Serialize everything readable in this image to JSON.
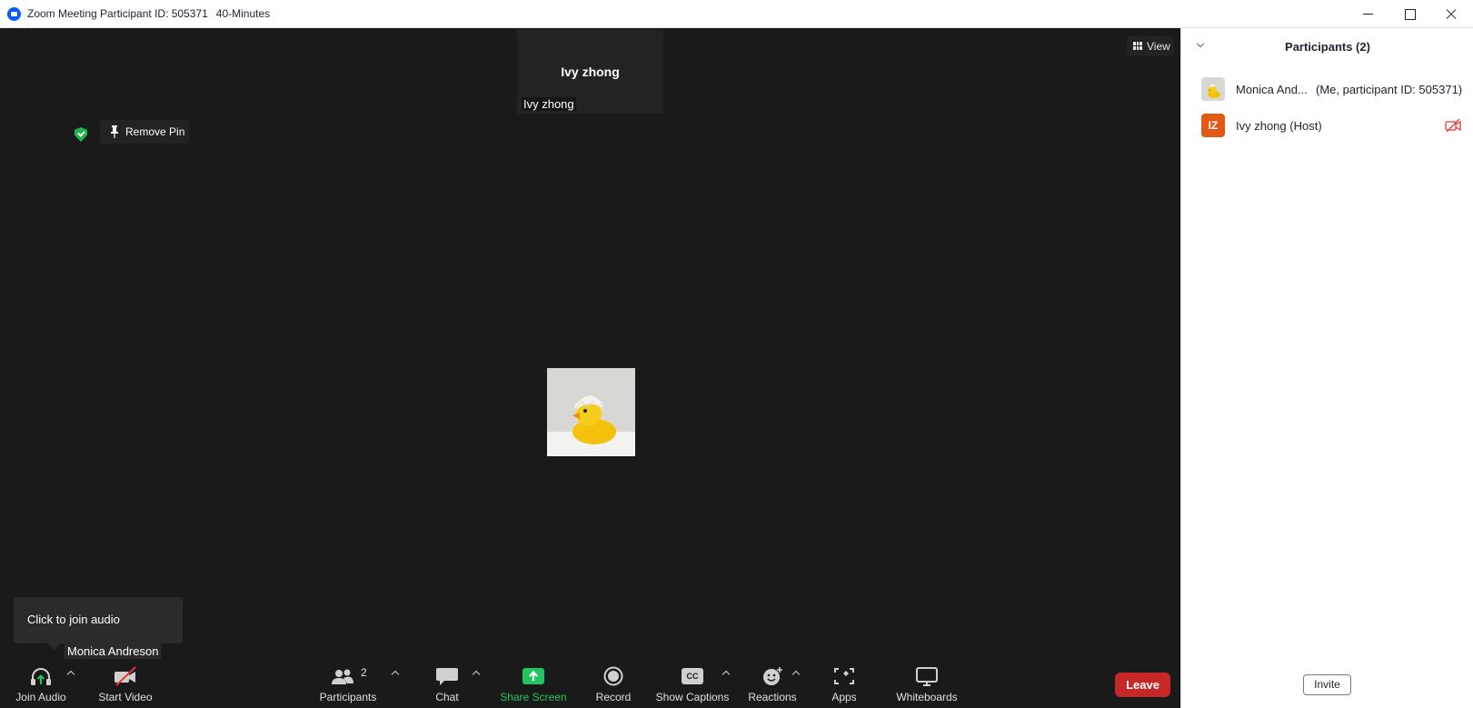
{
  "window": {
    "title": "Zoom Meeting Participant ID: 505371",
    "time_limit": "40-Minutes"
  },
  "stage": {
    "thumbnail": {
      "display_name": "Ivy zhong",
      "name_label": "Ivy zhong"
    },
    "view_button": "View",
    "remove_pin": "Remove Pin",
    "tooltip": "Click to join audio",
    "self_name": "Monica Andreson"
  },
  "toolbar": {
    "join_audio": "Join Audio",
    "start_video": "Start Video",
    "participants": "Participants",
    "participants_count": "2",
    "chat": "Chat",
    "share_screen": "Share Screen",
    "record": "Record",
    "show_captions": "Show Captions",
    "captions_badge": "CC",
    "reactions": "Reactions",
    "apps": "Apps",
    "whiteboards": "Whiteboards",
    "leave": "Leave"
  },
  "panel": {
    "title": "Participants (2)",
    "participants": [
      {
        "name": "Monica And...",
        "tag": "(Me, participant ID: 505371)",
        "avatar": "duck-photo"
      },
      {
        "name": "Ivy zhong (Host)",
        "initials": "IZ",
        "video_off": true
      }
    ],
    "invite": "Invite"
  },
  "colors": {
    "share_screen": "#22c55e",
    "leave": "#c62828",
    "host_avatar": "#e05a16",
    "shield": "#22b14c"
  }
}
